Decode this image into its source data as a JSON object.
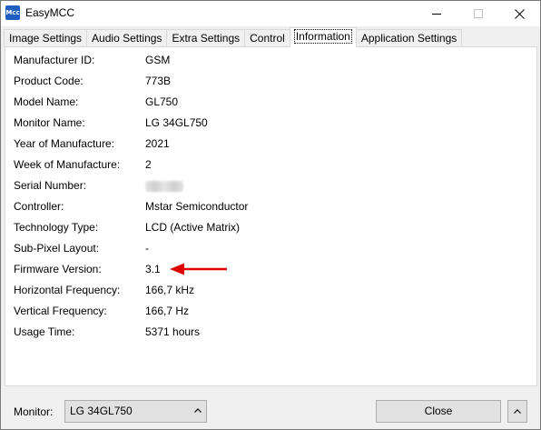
{
  "window": {
    "title": "EasyMCC",
    "icon_text": "Mcc",
    "controls": [
      "minimize-icon",
      "maximize-icon",
      "close-icon"
    ]
  },
  "tabs": [
    {
      "label": "Image Settings",
      "active": false
    },
    {
      "label": "Audio Settings",
      "active": false
    },
    {
      "label": "Extra Settings",
      "active": false
    },
    {
      "label": "Control",
      "active": false
    },
    {
      "label": "Information",
      "active": true
    },
    {
      "label": "Application Settings",
      "active": false
    }
  ],
  "info": [
    {
      "label": "Manufacturer ID:",
      "value": "GSM"
    },
    {
      "label": "Product Code:",
      "value": "773B"
    },
    {
      "label": "Model Name:",
      "value": "GL750"
    },
    {
      "label": "Monitor Name:",
      "value": "LG 34GL750"
    },
    {
      "label": "Year of Manufacture:",
      "value": "2021"
    },
    {
      "label": "Week of Manufacture:",
      "value": "2"
    },
    {
      "label": "Serial Number:",
      "value": ""
    },
    {
      "label": "Controller:",
      "value": "Mstar Semiconductor"
    },
    {
      "label": "Technology Type:",
      "value": "LCD (Active Matrix)"
    },
    {
      "label": "Sub-Pixel Layout:",
      "value": "-"
    },
    {
      "label": "Firmware Version:",
      "value": "3.1"
    },
    {
      "label": "Horizontal Frequency:",
      "value": "166,7 kHz"
    },
    {
      "label": "Vertical Frequency:",
      "value": "166,7 Hz"
    },
    {
      "label": "Usage Time:",
      "value": "5371 hours"
    }
  ],
  "footer": {
    "monitor_label": "Monitor:",
    "monitor_selected": "LG 34GL750",
    "close_label": "Close"
  },
  "colors": {
    "annotation_arrow": "#e00000",
    "app_icon": "#1f5fbf"
  }
}
